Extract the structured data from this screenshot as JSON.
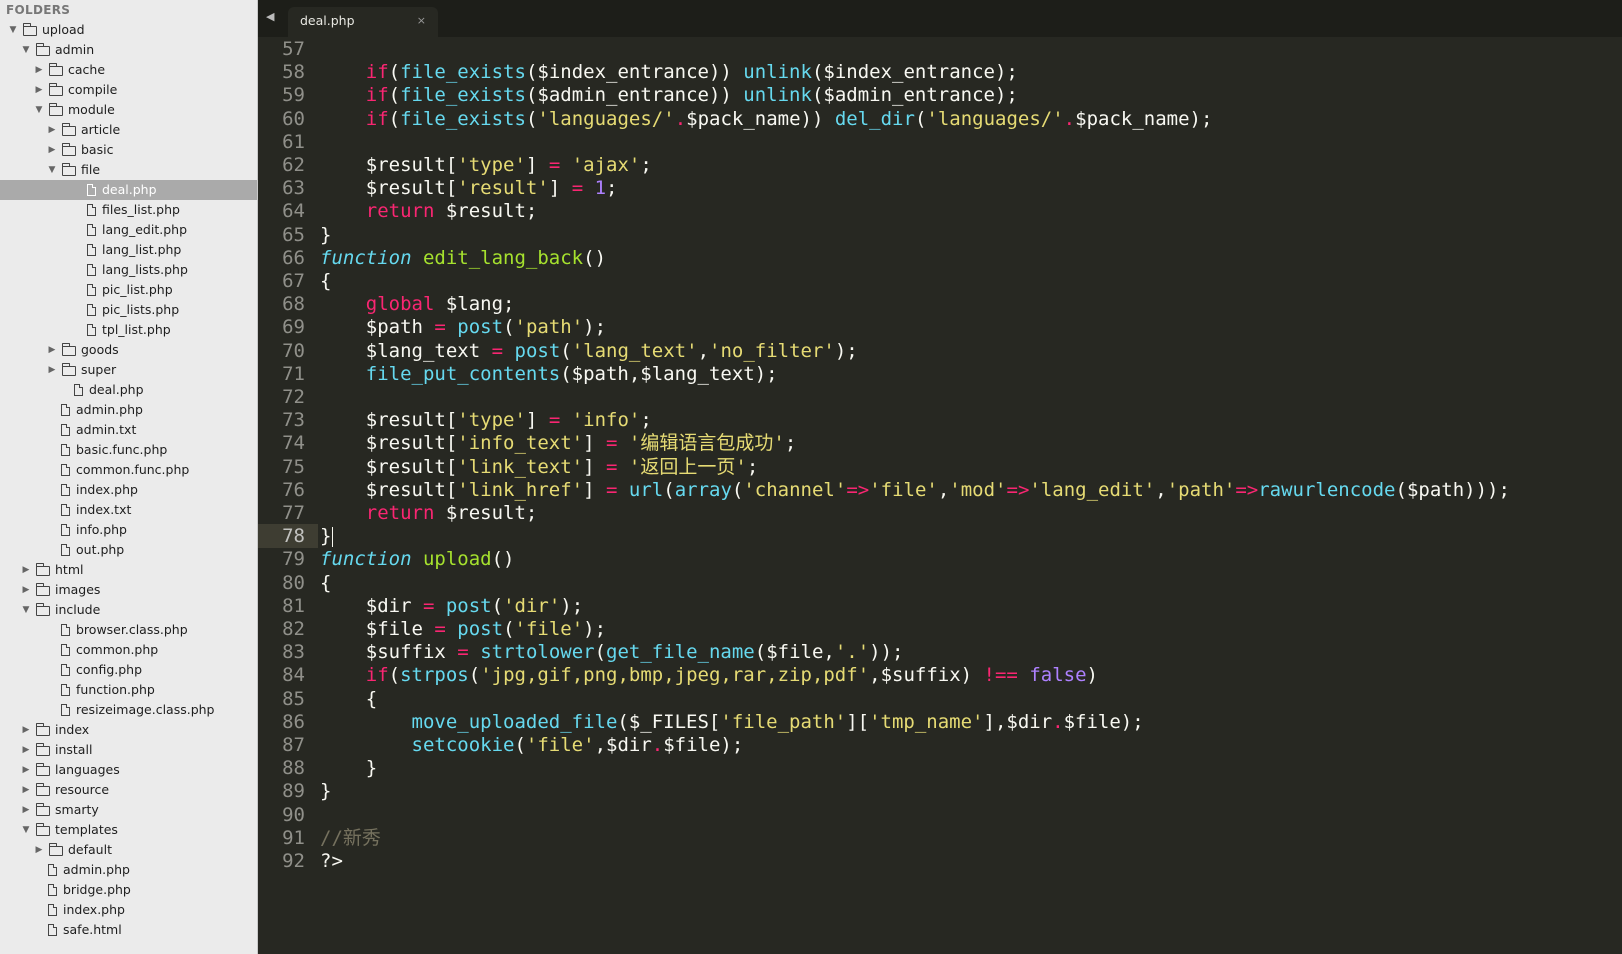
{
  "sidebar": {
    "header": "FOLDERS",
    "tree": [
      {
        "label": "upload",
        "type": "folder",
        "depth": 0,
        "open": true
      },
      {
        "label": "admin",
        "type": "folder",
        "depth": 1,
        "open": true
      },
      {
        "label": "cache",
        "type": "folder",
        "depth": 2,
        "open": false
      },
      {
        "label": "compile",
        "type": "folder",
        "depth": 2,
        "open": false
      },
      {
        "label": "module",
        "type": "folder",
        "depth": 2,
        "open": true
      },
      {
        "label": "article",
        "type": "folder",
        "depth": 3,
        "open": false
      },
      {
        "label": "basic",
        "type": "folder",
        "depth": 3,
        "open": false
      },
      {
        "label": "file",
        "type": "folder",
        "depth": 3,
        "open": true
      },
      {
        "label": "deal.php",
        "type": "file",
        "depth": 4,
        "selected": true
      },
      {
        "label": "files_list.php",
        "type": "file",
        "depth": 4
      },
      {
        "label": "lang_edit.php",
        "type": "file",
        "depth": 4
      },
      {
        "label": "lang_list.php",
        "type": "file",
        "depth": 4
      },
      {
        "label": "lang_lists.php",
        "type": "file",
        "depth": 4
      },
      {
        "label": "pic_list.php",
        "type": "file",
        "depth": 4
      },
      {
        "label": "pic_lists.php",
        "type": "file",
        "depth": 4
      },
      {
        "label": "tpl_list.php",
        "type": "file",
        "depth": 4
      },
      {
        "label": "goods",
        "type": "folder",
        "depth": 3,
        "open": false
      },
      {
        "label": "super",
        "type": "folder",
        "depth": 3,
        "open": false
      },
      {
        "label": "deal.php",
        "type": "file",
        "depth": 3
      },
      {
        "label": "admin.php",
        "type": "file",
        "depth": 2
      },
      {
        "label": "admin.txt",
        "type": "file",
        "depth": 2
      },
      {
        "label": "basic.func.php",
        "type": "file",
        "depth": 2
      },
      {
        "label": "common.func.php",
        "type": "file",
        "depth": 2
      },
      {
        "label": "index.php",
        "type": "file",
        "depth": 2
      },
      {
        "label": "index.txt",
        "type": "file",
        "depth": 2
      },
      {
        "label": "info.php",
        "type": "file",
        "depth": 2
      },
      {
        "label": "out.php",
        "type": "file",
        "depth": 2
      },
      {
        "label": "html",
        "type": "folder",
        "depth": 1,
        "open": false
      },
      {
        "label": "images",
        "type": "folder",
        "depth": 1,
        "open": false
      },
      {
        "label": "include",
        "type": "folder",
        "depth": 1,
        "open": true
      },
      {
        "label": "browser.class.php",
        "type": "file",
        "depth": 2
      },
      {
        "label": "common.php",
        "type": "file",
        "depth": 2
      },
      {
        "label": "config.php",
        "type": "file",
        "depth": 2
      },
      {
        "label": "function.php",
        "type": "file",
        "depth": 2
      },
      {
        "label": "resizeimage.class.php",
        "type": "file",
        "depth": 2
      },
      {
        "label": "index",
        "type": "folder",
        "depth": 1,
        "open": false
      },
      {
        "label": "install",
        "type": "folder",
        "depth": 1,
        "open": false
      },
      {
        "label": "languages",
        "type": "folder",
        "depth": 1,
        "open": false
      },
      {
        "label": "resource",
        "type": "folder",
        "depth": 1,
        "open": false
      },
      {
        "label": "smarty",
        "type": "folder",
        "depth": 1,
        "open": false
      },
      {
        "label": "templates",
        "type": "folder",
        "depth": 1,
        "open": true
      },
      {
        "label": "default",
        "type": "folder",
        "depth": 2,
        "open": false
      },
      {
        "label": "admin.php",
        "type": "file",
        "depth": 1
      },
      {
        "label": "bridge.php",
        "type": "file",
        "depth": 1
      },
      {
        "label": "index.php",
        "type": "file",
        "depth": 1
      },
      {
        "label": "safe.html",
        "type": "file",
        "depth": 1
      }
    ]
  },
  "tabs": {
    "nav_arrows": "◀ ▶",
    "active_tab": {
      "label": "deal.php",
      "close": "×"
    }
  },
  "editor": {
    "current_line": 78,
    "lines": [
      {
        "n": "57",
        "segs": []
      },
      {
        "n": "58",
        "segs": [
          [
            "    ",
            ""
          ],
          [
            "if",
            "kw"
          ],
          [
            "(",
            ""
          ],
          [
            "file_exists",
            "fn"
          ],
          [
            "($index_entrance)) ",
            ""
          ],
          [
            "unlink",
            "fn"
          ],
          [
            "($index_entrance);",
            ""
          ]
        ]
      },
      {
        "n": "59",
        "segs": [
          [
            "    ",
            ""
          ],
          [
            "if",
            "kw"
          ],
          [
            "(",
            ""
          ],
          [
            "file_exists",
            "fn"
          ],
          [
            "($admin_entrance)) ",
            ""
          ],
          [
            "unlink",
            "fn"
          ],
          [
            "($admin_entrance);",
            ""
          ]
        ]
      },
      {
        "n": "60",
        "segs": [
          [
            "    ",
            ""
          ],
          [
            "if",
            "kw"
          ],
          [
            "(",
            ""
          ],
          [
            "file_exists",
            "fn"
          ],
          [
            "(",
            ""
          ],
          [
            "'languages/'",
            "str"
          ],
          [
            ".",
            "op"
          ],
          [
            "$pack_name)) ",
            ""
          ],
          [
            "del_dir",
            "fn"
          ],
          [
            "(",
            ""
          ],
          [
            "'languages/'",
            "str"
          ],
          [
            ".",
            "op"
          ],
          [
            "$pack_name);",
            ""
          ]
        ]
      },
      {
        "n": "61",
        "segs": []
      },
      {
        "n": "62",
        "segs": [
          [
            "    $result[",
            ""
          ],
          [
            "'type'",
            "str"
          ],
          [
            "] ",
            ""
          ],
          [
            "=",
            "op"
          ],
          [
            " ",
            ""
          ],
          [
            "'ajax'",
            "str"
          ],
          [
            ";",
            ""
          ]
        ]
      },
      {
        "n": "63",
        "segs": [
          [
            "    $result[",
            ""
          ],
          [
            "'result'",
            "str"
          ],
          [
            "] ",
            ""
          ],
          [
            "=",
            "op"
          ],
          [
            " ",
            ""
          ],
          [
            "1",
            "num"
          ],
          [
            ";",
            ""
          ]
        ]
      },
      {
        "n": "64",
        "segs": [
          [
            "    ",
            ""
          ],
          [
            "return",
            "kw"
          ],
          [
            " $result;",
            ""
          ]
        ]
      },
      {
        "n": "65",
        "segs": [
          [
            "}",
            ""
          ]
        ]
      },
      {
        "n": "66",
        "segs": [
          [
            "function",
            "decl"
          ],
          [
            " ",
            ""
          ],
          [
            "edit_lang_back",
            "name"
          ],
          [
            "()",
            ""
          ]
        ]
      },
      {
        "n": "67",
        "segs": [
          [
            "{",
            ""
          ]
        ]
      },
      {
        "n": "68",
        "segs": [
          [
            "    ",
            ""
          ],
          [
            "global",
            "kw"
          ],
          [
            " $lang;",
            ""
          ]
        ]
      },
      {
        "n": "69",
        "segs": [
          [
            "    $path ",
            ""
          ],
          [
            "=",
            "op"
          ],
          [
            " ",
            ""
          ],
          [
            "post",
            "fn"
          ],
          [
            "(",
            ""
          ],
          [
            "'path'",
            "str"
          ],
          [
            ");",
            ""
          ]
        ]
      },
      {
        "n": "70",
        "segs": [
          [
            "    $lang_text ",
            ""
          ],
          [
            "=",
            "op"
          ],
          [
            " ",
            ""
          ],
          [
            "post",
            "fn"
          ],
          [
            "(",
            ""
          ],
          [
            "'lang_text'",
            "str"
          ],
          [
            ",",
            ""
          ],
          [
            "'no_filter'",
            "str"
          ],
          [
            ");",
            ""
          ]
        ]
      },
      {
        "n": "71",
        "segs": [
          [
            "    ",
            ""
          ],
          [
            "file_put_contents",
            "fn"
          ],
          [
            "($path,$lang_text);",
            ""
          ]
        ]
      },
      {
        "n": "72",
        "segs": []
      },
      {
        "n": "73",
        "segs": [
          [
            "    $result[",
            ""
          ],
          [
            "'type'",
            "str"
          ],
          [
            "] ",
            ""
          ],
          [
            "=",
            "op"
          ],
          [
            " ",
            ""
          ],
          [
            "'info'",
            "str"
          ],
          [
            ";",
            ""
          ]
        ]
      },
      {
        "n": "74",
        "segs": [
          [
            "    $result[",
            ""
          ],
          [
            "'info_text'",
            "str"
          ],
          [
            "] ",
            ""
          ],
          [
            "=",
            "op"
          ],
          [
            " ",
            ""
          ],
          [
            "'编辑语言包成功'",
            "str"
          ],
          [
            ";",
            ""
          ]
        ]
      },
      {
        "n": "75",
        "segs": [
          [
            "    $result[",
            ""
          ],
          [
            "'link_text'",
            "str"
          ],
          [
            "] ",
            ""
          ],
          [
            "=",
            "op"
          ],
          [
            " ",
            ""
          ],
          [
            "'返回上一页'",
            "str"
          ],
          [
            ";",
            ""
          ]
        ]
      },
      {
        "n": "76",
        "segs": [
          [
            "    $result[",
            ""
          ],
          [
            "'link_href'",
            "str"
          ],
          [
            "] ",
            ""
          ],
          [
            "=",
            "op"
          ],
          [
            " ",
            ""
          ],
          [
            "url",
            "fn"
          ],
          [
            "(",
            ""
          ],
          [
            "array",
            "fn"
          ],
          [
            "(",
            ""
          ],
          [
            "'channel'",
            "str"
          ],
          [
            "=>",
            "op"
          ],
          [
            "'file'",
            "str"
          ],
          [
            ",",
            ""
          ],
          [
            "'mod'",
            "str"
          ],
          [
            "=>",
            "op"
          ],
          [
            "'lang_edit'",
            "str"
          ],
          [
            ",",
            ""
          ],
          [
            "'path'",
            "str"
          ],
          [
            "=>",
            "op"
          ],
          [
            "rawurlencode",
            "fn"
          ],
          [
            "($path)));",
            ""
          ]
        ]
      },
      {
        "n": "77",
        "segs": [
          [
            "    ",
            ""
          ],
          [
            "return",
            "kw"
          ],
          [
            " $result;",
            ""
          ]
        ]
      },
      {
        "n": "78",
        "segs": [
          [
            "}",
            ""
          ]
        ],
        "caret": true
      },
      {
        "n": "79",
        "segs": [
          [
            "function",
            "decl"
          ],
          [
            " ",
            ""
          ],
          [
            "upload",
            "name"
          ],
          [
            "()",
            ""
          ]
        ]
      },
      {
        "n": "80",
        "segs": [
          [
            "{",
            ""
          ]
        ]
      },
      {
        "n": "81",
        "segs": [
          [
            "    $dir ",
            ""
          ],
          [
            "=",
            "op"
          ],
          [
            " ",
            ""
          ],
          [
            "post",
            "fn"
          ],
          [
            "(",
            ""
          ],
          [
            "'dir'",
            "str"
          ],
          [
            ");",
            ""
          ]
        ]
      },
      {
        "n": "82",
        "segs": [
          [
            "    $file ",
            ""
          ],
          [
            "=",
            "op"
          ],
          [
            " ",
            ""
          ],
          [
            "post",
            "fn"
          ],
          [
            "(",
            ""
          ],
          [
            "'file'",
            "str"
          ],
          [
            ");",
            ""
          ]
        ]
      },
      {
        "n": "83",
        "segs": [
          [
            "    $suffix ",
            ""
          ],
          [
            "=",
            "op"
          ],
          [
            " ",
            ""
          ],
          [
            "strtolower",
            "fn"
          ],
          [
            "(",
            ""
          ],
          [
            "get_file_name",
            "fn"
          ],
          [
            "($file,",
            ""
          ],
          [
            "'.'",
            "str"
          ],
          [
            "));",
            ""
          ]
        ]
      },
      {
        "n": "84",
        "segs": [
          [
            "    ",
            ""
          ],
          [
            "if",
            "kw"
          ],
          [
            "(",
            ""
          ],
          [
            "strpos",
            "fn"
          ],
          [
            "(",
            ""
          ],
          [
            "'jpg,gif,png,bmp,jpeg,rar,zip,pdf'",
            "str"
          ],
          [
            ",$suffix) ",
            ""
          ],
          [
            "!==",
            "op"
          ],
          [
            " ",
            ""
          ],
          [
            "false",
            "const"
          ],
          [
            ")",
            ""
          ]
        ]
      },
      {
        "n": "85",
        "segs": [
          [
            "    {",
            ""
          ]
        ]
      },
      {
        "n": "86",
        "segs": [
          [
            "        ",
            ""
          ],
          [
            "move_uploaded_file",
            "fn"
          ],
          [
            "($_FILES[",
            ""
          ],
          [
            "'file_path'",
            "str"
          ],
          [
            "][",
            ""
          ],
          [
            "'tmp_name'",
            "str"
          ],
          [
            "],$dir",
            ""
          ],
          [
            ".",
            "op"
          ],
          [
            "$file);",
            ""
          ]
        ]
      },
      {
        "n": "87",
        "segs": [
          [
            "        ",
            ""
          ],
          [
            "setcookie",
            "fn"
          ],
          [
            "(",
            ""
          ],
          [
            "'file'",
            "str"
          ],
          [
            ",$dir",
            ""
          ],
          [
            ".",
            "op"
          ],
          [
            "$file);",
            ""
          ]
        ]
      },
      {
        "n": "88",
        "segs": [
          [
            "    }",
            ""
          ]
        ]
      },
      {
        "n": "89",
        "segs": [
          [
            "}",
            ""
          ]
        ]
      },
      {
        "n": "90",
        "segs": []
      },
      {
        "n": "91",
        "segs": [
          [
            "//新秀",
            "cmt"
          ]
        ]
      },
      {
        "n": "92",
        "segs": [
          [
            "?>",
            ""
          ]
        ]
      }
    ]
  }
}
